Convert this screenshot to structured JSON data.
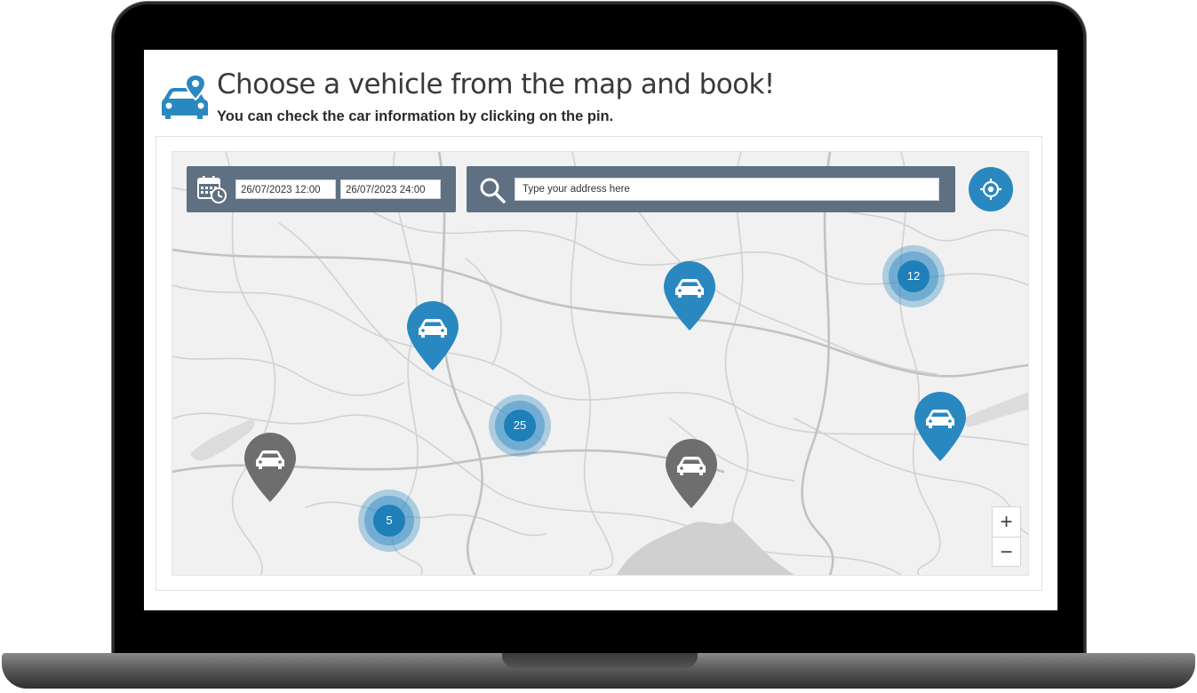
{
  "header": {
    "title": "Choose a vehicle from the map and book!",
    "subtitle": "You can check the car information by clicking on the pin.",
    "icon": "car-location-icon"
  },
  "filters": {
    "date_start": "26/07/2023 12:00",
    "date_end": "26/07/2023 24:00",
    "calendar_icon": "calendar-clock-icon",
    "search_icon": "search-icon",
    "address_placeholder": "Type your address here",
    "address_value": ""
  },
  "map": {
    "locate_icon": "crosshair-icon",
    "pins": [
      {
        "status": "available",
        "color": "#2a88c0",
        "icon": "car-icon"
      },
      {
        "status": "available",
        "color": "#2a88c0",
        "icon": "car-icon"
      },
      {
        "status": "available",
        "color": "#2a88c0",
        "icon": "car-icon"
      },
      {
        "status": "unavailable",
        "color": "#6e6e6e",
        "icon": "car-icon"
      },
      {
        "status": "unavailable",
        "color": "#6e6e6e",
        "icon": "car-icon"
      }
    ],
    "clusters": [
      {
        "count": "12"
      },
      {
        "count": "25"
      },
      {
        "count": "5"
      }
    ],
    "zoom": {
      "in": "+",
      "out": "−"
    }
  },
  "colors": {
    "accent": "#2a88c0",
    "panel": "#5e7081",
    "unavailable": "#6e6e6e"
  }
}
